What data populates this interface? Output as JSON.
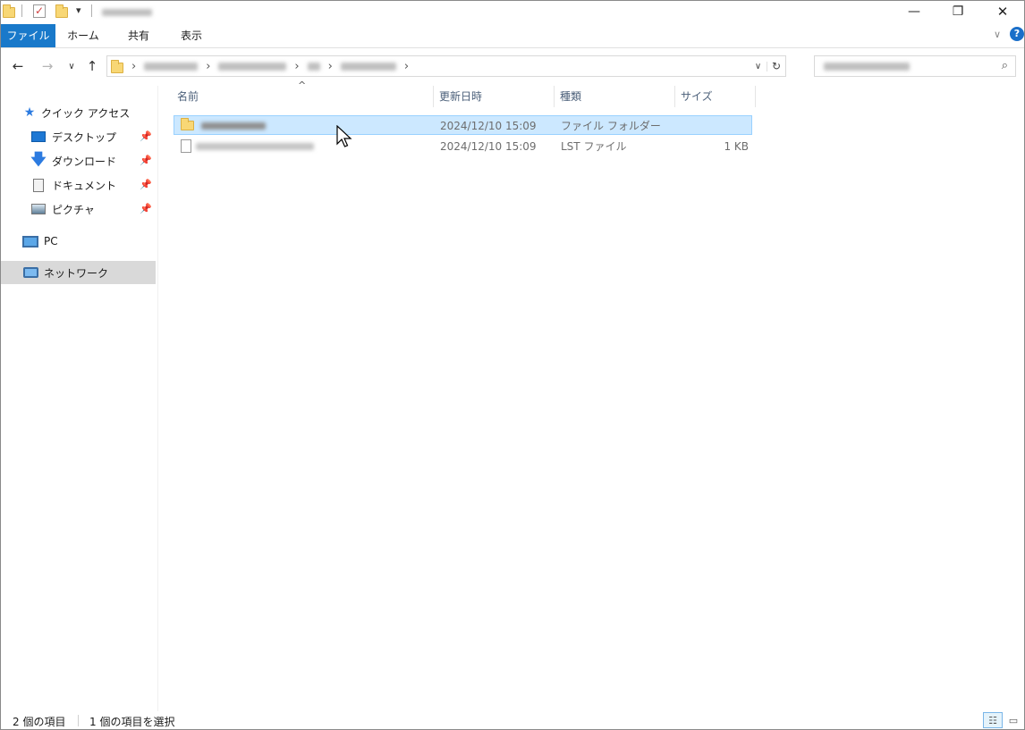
{
  "window": {
    "controls": {
      "minimize": "—",
      "restore": "❐",
      "close": "✕"
    }
  },
  "ribbon": {
    "tabs": [
      "ファイル",
      "ホーム",
      "共有",
      "表示"
    ],
    "collapse_glyph": "∨",
    "help_glyph": "?"
  },
  "nav": {
    "back": "←",
    "forward": "→",
    "recent": "∨",
    "up": "↑",
    "address_dropdown": "∨",
    "refresh": "↻",
    "search_icon": "⌕"
  },
  "sidebar": {
    "items": [
      {
        "label": "クイック アクセス",
        "icon": "star-icon",
        "pinned": false
      },
      {
        "label": "デスクトップ",
        "icon": "desktop-icon",
        "pinned": true
      },
      {
        "label": "ダウンロード",
        "icon": "download-icon",
        "pinned": true
      },
      {
        "label": "ドキュメント",
        "icon": "document-icon",
        "pinned": true
      },
      {
        "label": "ピクチャ",
        "icon": "picture-icon",
        "pinned": true
      },
      {
        "label": "PC",
        "icon": "pc-icon",
        "pinned": false
      },
      {
        "label": "ネットワーク",
        "icon": "network-icon",
        "pinned": false,
        "selected": true
      }
    ]
  },
  "list": {
    "columns": [
      "名前",
      "更新日時",
      "種類",
      "サイズ"
    ],
    "rows": [
      {
        "date": "2024/12/10 15:09",
        "type": "ファイル フォルダー",
        "size": "",
        "icon": "folder-icon",
        "selected": true
      },
      {
        "date": "2024/12/10 15:09",
        "type": "LST ファイル",
        "size": "1 KB",
        "icon": "file-icon",
        "selected": false
      }
    ]
  },
  "status": {
    "count": "2 個の項目",
    "selection": "1 個の項目を選択"
  },
  "colors": {
    "accent": "#1979ca",
    "selection_bg": "#cce8ff",
    "selection_border": "#99d1ff",
    "column_header": "#4c607a"
  }
}
